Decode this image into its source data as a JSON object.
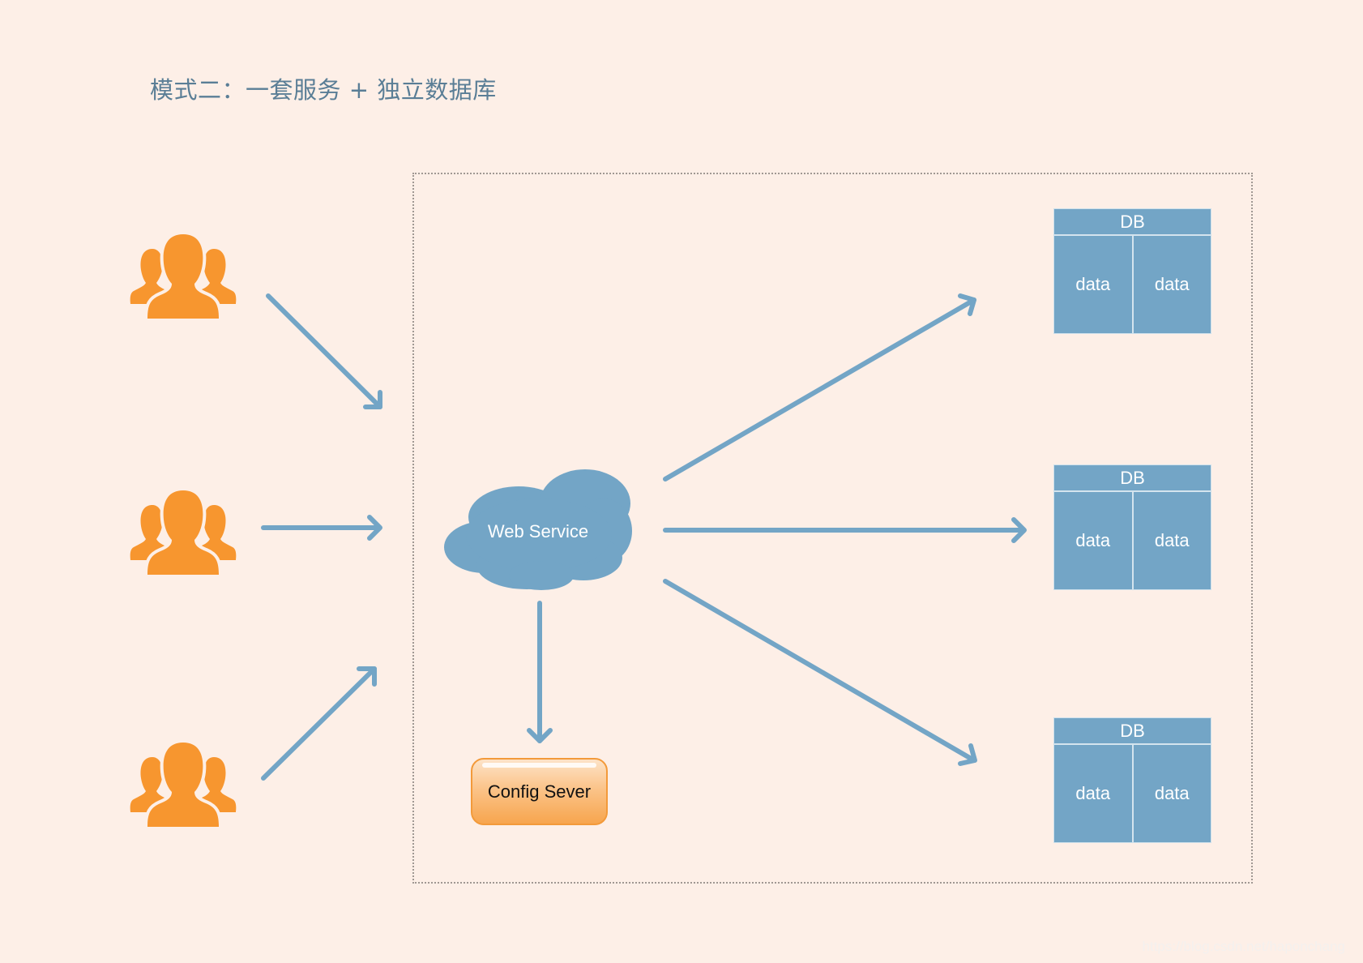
{
  "title": "模式二：一套服务 + 独立数据库",
  "colors": {
    "background": "#fdefe7",
    "accent_blue": "#73a5c6",
    "accent_orange": "#f7962f",
    "title_text": "#5a7e96",
    "frame_border": "#a09893"
  },
  "user_groups": [
    {
      "icon": "users-group-icon"
    },
    {
      "icon": "users-group-icon"
    },
    {
      "icon": "users-group-icon"
    }
  ],
  "web_service": {
    "label": "Web Service",
    "icon": "cloud-icon"
  },
  "config_server": {
    "label": "Config Sever"
  },
  "databases": [
    {
      "header": "DB",
      "cells": [
        "data",
        "data"
      ]
    },
    {
      "header": "DB",
      "cells": [
        "data",
        "data"
      ]
    },
    {
      "header": "DB",
      "cells": [
        "data",
        "data"
      ]
    }
  ],
  "watermark": "https://blog.csdn.net/haponchang"
}
